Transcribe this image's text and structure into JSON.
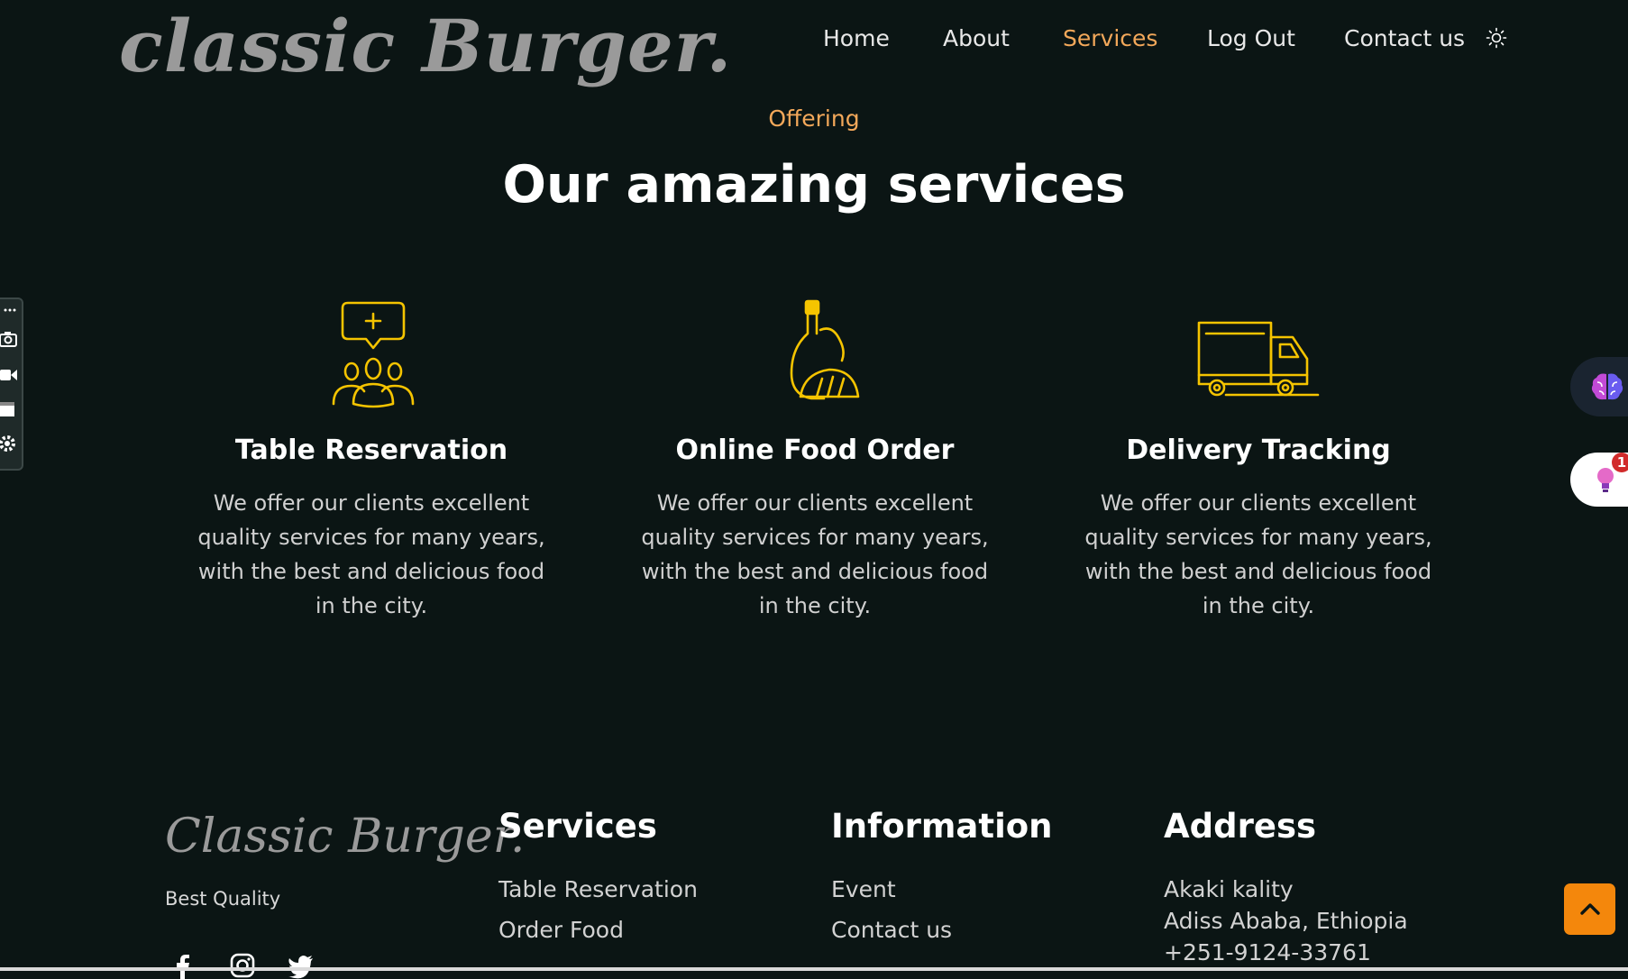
{
  "header": {
    "logo": "classic Burger.",
    "nav": [
      {
        "label": "Home",
        "active": false
      },
      {
        "label": "About",
        "active": false
      },
      {
        "label": "Services",
        "active": true
      },
      {
        "label": "Log Out",
        "active": false
      },
      {
        "label": "Contact us",
        "active": false
      }
    ],
    "theme_icon": "sun-icon"
  },
  "services": {
    "eyebrow": "Offering",
    "title": "Our amazing services",
    "cards": [
      {
        "icon": "table-reservation-icon",
        "title": "Table Reservation",
        "text": "We offer our clients excellent quality services for many years, with the best and delicious food in the city."
      },
      {
        "icon": "food-order-icon",
        "title": "Online Food Order",
        "text": "We offer our clients excellent quality services for many years, with the best and delicious food in the city."
      },
      {
        "icon": "delivery-truck-icon",
        "title": "Delivery Tracking",
        "text": "We offer our clients excellent quality services for many years, with the best and delicious food in the city."
      }
    ]
  },
  "footer": {
    "logo": "Classic Burger.",
    "tagline": "Best Quality",
    "social": [
      "facebook-icon",
      "instagram-icon",
      "twitter-icon"
    ],
    "columns": [
      {
        "title": "Services",
        "links": [
          "Table Reservation",
          "Order Food"
        ]
      },
      {
        "title": "Information",
        "links": [
          "Event",
          "Contact us"
        ]
      },
      {
        "title": "Address",
        "lines": [
          "Akaki kality",
          "Adiss Ababa, Ethiopia",
          "+251-9124-33761"
        ]
      }
    ]
  },
  "overlays": {
    "extension_badge_count": "1",
    "accent_color": "#f3a85a",
    "scroll_button_color": "#f4870c"
  }
}
